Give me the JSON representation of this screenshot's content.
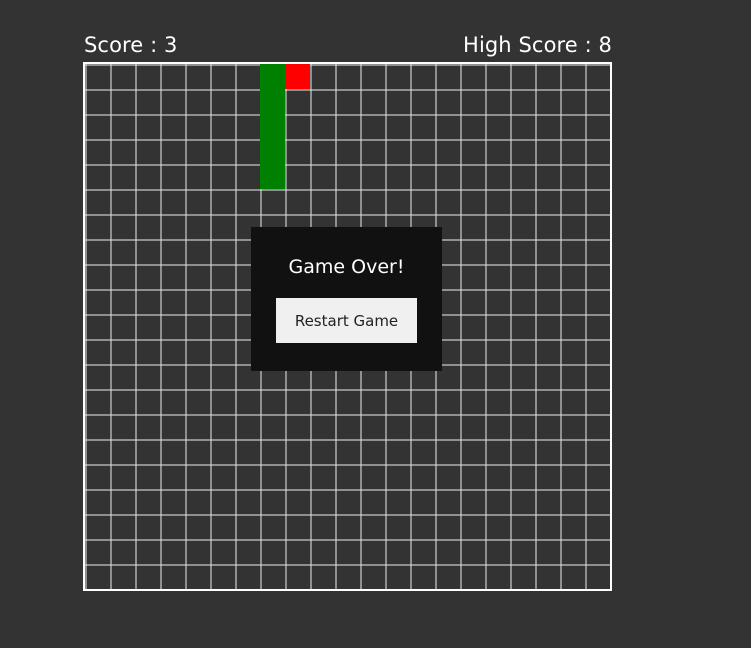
{
  "hud": {
    "score_text": "Score : 3",
    "high_score_text": "High Score : 8"
  },
  "board": {
    "columns": 21,
    "rows": 21,
    "snake": [
      [
        7,
        0
      ],
      [
        7,
        1
      ],
      [
        7,
        2
      ],
      [
        7,
        3
      ],
      [
        7,
        4
      ]
    ],
    "food": [
      8,
      0
    ]
  },
  "game_over": {
    "title": "Game Over!",
    "restart_label": "Restart Game"
  },
  "colors": {
    "background": "#333333",
    "snake": "#008000",
    "food": "#ff0000",
    "overlay": "#111111",
    "button": "#f0f0f0"
  }
}
